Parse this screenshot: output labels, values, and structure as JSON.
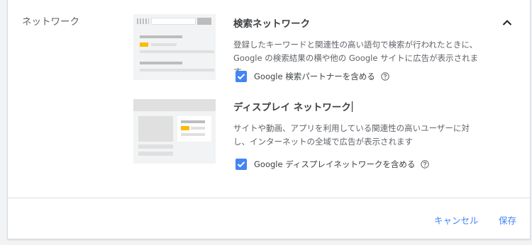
{
  "section": {
    "title": "ネットワーク"
  },
  "search_network": {
    "title": "検索ネットワーク",
    "description_line1": "登録したキーワードと関連性の高い語句で検索が行われたときに、",
    "description_line2": "Google の検索結果の横や他の Google サイトに広告が表示されます",
    "checkbox_label": "Google 検索パートナーを含める",
    "checkbox_checked": true
  },
  "display_network": {
    "title": "ディスプレイ ネットワーク",
    "description_line1": "サイトや動画、アプリを利用している関連性の高いユーザーに対",
    "description_line2": "し、インターネットの全域で広告が表示されます",
    "checkbox_label": "Google ディスプレイネットワークを含める",
    "checkbox_checked": true
  },
  "footer": {
    "cancel_label": "キャンセル",
    "save_label": "保存"
  },
  "colors": {
    "accent": "#4285f4",
    "ad_highlight": "#fbbc04",
    "illustration_bg": "#f1f3f4"
  },
  "icons": {
    "collapse": "chevron-up-icon",
    "help": "help-circle-icon",
    "check": "checkmark-icon"
  }
}
